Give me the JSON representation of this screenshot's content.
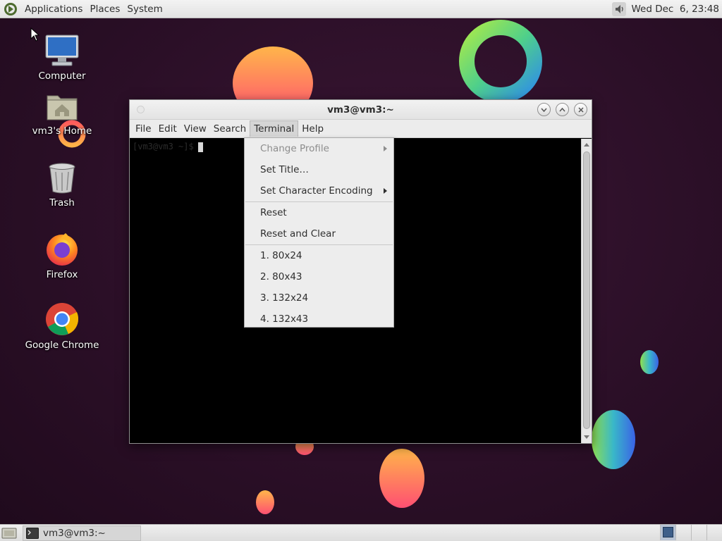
{
  "top_panel": {
    "menus": [
      "Applications",
      "Places",
      "System"
    ],
    "clock": "Wed Dec  6, 23:48"
  },
  "desktop": {
    "icons": [
      {
        "label": "Computer",
        "icon": "computer-icon"
      },
      {
        "label": "vm3's Home",
        "icon": "home-folder-icon"
      },
      {
        "label": "Trash",
        "icon": "trash-icon"
      },
      {
        "label": "Firefox",
        "icon": "firefox-icon"
      },
      {
        "label": "Google Chrome",
        "icon": "chrome-icon"
      }
    ]
  },
  "window": {
    "title": "vm3@vm3:~",
    "menus": [
      "File",
      "Edit",
      "View",
      "Search",
      "Terminal",
      "Help"
    ],
    "active_menu": "Terminal",
    "prompt": "[vm3@vm3 ~]$"
  },
  "terminal_menu": {
    "items": [
      {
        "label": "Change Profile",
        "disabled": true,
        "submenu": true
      },
      {
        "label": "Set Title…",
        "disabled": false,
        "submenu": false
      },
      {
        "label": "Set Character Encoding",
        "disabled": false,
        "submenu": true
      },
      {
        "label": "Reset",
        "disabled": false,
        "submenu": false
      },
      {
        "label": "Reset and Clear",
        "disabled": false,
        "submenu": false
      },
      {
        "label": "1. 80x24",
        "disabled": false,
        "submenu": false
      },
      {
        "label": "2. 80x43",
        "disabled": false,
        "submenu": false
      },
      {
        "label": "3. 132x24",
        "disabled": false,
        "submenu": false
      },
      {
        "label": "4. 132x43",
        "disabled": false,
        "submenu": false
      }
    ]
  },
  "taskbar": {
    "tasks": [
      {
        "label": "vm3@vm3:~"
      }
    ]
  },
  "colors": {
    "panel": "#e6e6e6",
    "desktop_bg": "#2b0f27",
    "terminal_bg": "#000000",
    "menu_bg": "#ededed"
  }
}
